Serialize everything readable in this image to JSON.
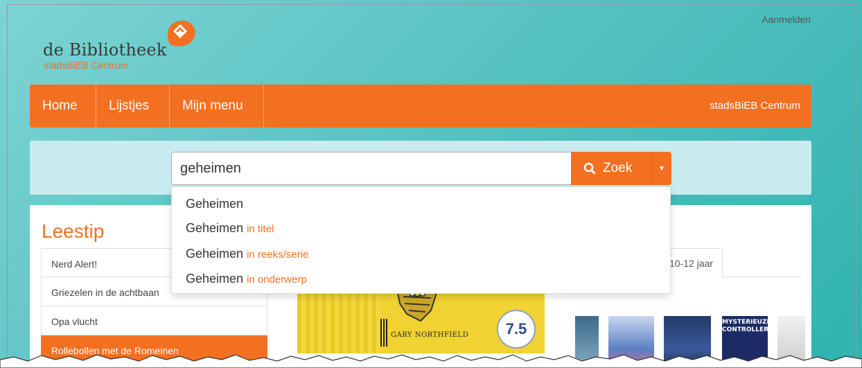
{
  "header": {
    "login_label": "Aanmelden",
    "logo_text": "de Bibliotheek",
    "logo_sub": "stadsBiEB Centrum"
  },
  "nav": {
    "items": [
      {
        "label": "Home"
      },
      {
        "label": "Lijstjes"
      },
      {
        "label": "Mijn menu"
      }
    ],
    "branch": "stadsBiEB Centrum"
  },
  "search": {
    "value": "geheimen",
    "button_label": "Zoek",
    "suggestions": [
      {
        "term": "Geheimen",
        "hint": ""
      },
      {
        "term": "Geheimen",
        "hint": "in titel"
      },
      {
        "term": "Geheimen",
        "hint": "in reeks/serie"
      },
      {
        "term": "Geheimen",
        "hint": "in onderwerp"
      }
    ]
  },
  "leestip": {
    "title": "Leestip",
    "items": [
      "Nerd Alert!",
      "Griezelen in de achtbaan",
      "Opa vlucht",
      "Rollebollen met de Romeinen"
    ],
    "active_index": 3,
    "book_author": "GARY NORTHFIELD",
    "rating": "7.5"
  },
  "age_tab": "10-12 jaar",
  "covers": {
    "mysterieuze": "MYSTERIEUZE CONTROLLER"
  },
  "colors": {
    "brand_orange": "#f37021",
    "search_band": "#c7ebee"
  }
}
